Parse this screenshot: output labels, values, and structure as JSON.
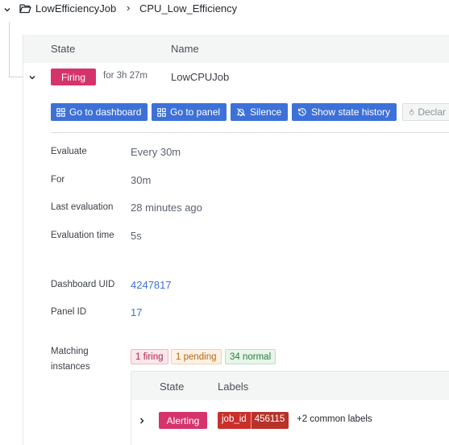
{
  "breadcrumb": {
    "folder": "LowEfficiencyJob",
    "separator": "›",
    "rule_group": "CPU_Low_Efficiency"
  },
  "rules_table": {
    "header_state": "State",
    "header_name": "Name",
    "row": {
      "state_badge": "Firing",
      "duration": "for 3h 27m",
      "name": "LowCPUJob"
    }
  },
  "actions": {
    "go_to_dashboard": "Go to dashboard",
    "go_to_panel": "Go to panel",
    "silence": "Silence",
    "show_state_history": "Show state history",
    "declare_incident": "Declar"
  },
  "details": {
    "evaluate_label": "Evaluate",
    "evaluate_value": "Every 30m",
    "for_label": "For",
    "for_value": "30m",
    "last_evaluation_label": "Last evaluation",
    "last_evaluation_value": "28 minutes ago",
    "evaluation_time_label": "Evaluation time",
    "evaluation_time_value": "5s",
    "dashboard_uid_label": "Dashboard UID",
    "dashboard_uid_value": "4247817",
    "panel_id_label": "Panel ID",
    "panel_id_value": "17",
    "matching_label_line1": "Matching",
    "matching_label_line2": "instances"
  },
  "instance_counts": {
    "firing": "1 firing",
    "pending": "1 pending",
    "normal": "34 normal"
  },
  "instances_table": {
    "header_state": "State",
    "header_labels": "Labels",
    "row": {
      "state_badge": "Alerting",
      "label_key": "job_id",
      "label_value": "456115",
      "common_labels": "+2 common labels"
    }
  },
  "colors": {
    "firing": "#d6336c",
    "alerting": "#d6336c",
    "primary": "#3d71d9",
    "label_key_bg": "#c9302c",
    "label_value_bg": "#c0392b"
  },
  "icons": {
    "expand": "chevron-down-icon",
    "folder": "folder-open-icon",
    "dashboard": "apps-icon",
    "silence": "bell-slash-icon",
    "history": "history-icon",
    "incident": "fire-icon",
    "row_expand": "chevron-right-icon"
  }
}
